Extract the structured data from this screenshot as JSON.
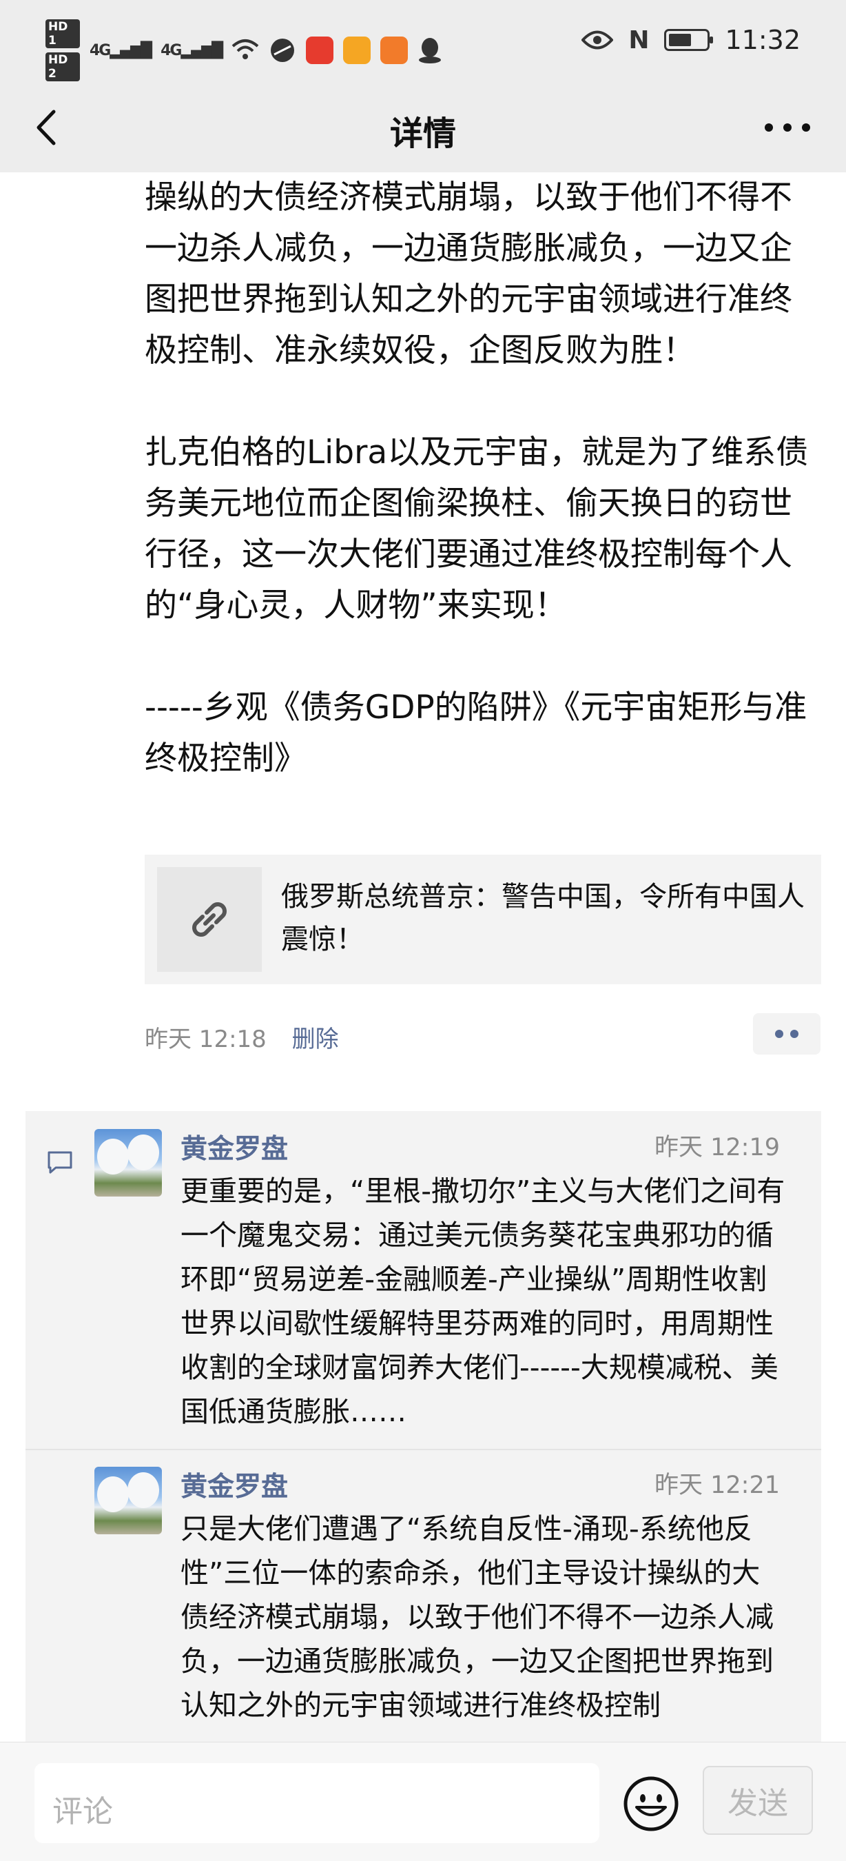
{
  "status_bar": {
    "hd1": "HD 1",
    "hd2": "HD 2",
    "sim1": "4G",
    "sim2": "4G",
    "nfc": "N",
    "time": "11:32"
  },
  "nav": {
    "title": "详情"
  },
  "post": {
    "paragraphs": [
      "操纵的大债经济模式崩塌，以致于他们不得不一边杀人减负，一边通货膨胀减负，一边又企图把世界拖到认知之外的元宇宙领域进行准终极控制、准永续奴役，企图反败为胜！",
      "扎克伯格的Libra以及元宇宙，就是为了维系债务美元地位而企图偷梁换柱、偷天换日的窃世行径，这一次大佬们要通过准终极控制每个人的“身心灵，人财物”来实现！",
      "-----乡观《债务GDP的陷阱》《元宇宙矩形与准终极控制》"
    ],
    "link_title": "俄罗斯总统普京：警告中国，令所有中国人震惊！",
    "time": "昨天 12:18",
    "delete_label": "删除"
  },
  "comments": [
    {
      "name": "黄金罗盘",
      "time": "昨天 12:19",
      "text": "更重要的是，“里根-撒切尔”主义与大佬们之间有一个魔鬼交易：通过美元债务葵花宝典邪功的循环即“贸易逆差-金融顺差-产业操纵”周期性收割世界以间歇性缓解特里芬两难的同时，用周期性收割的全球财富饲养大佬们------大规模减税、美国低通货膨胀……"
    },
    {
      "name": "黄金罗盘",
      "time": "昨天 12:21",
      "text": "只是大佬们遭遇了“系统自反性-涌现-系统他反性”三位一体的索命杀，他们主导设计操纵的大债经济模式崩塌，以致于他们不得不一边杀人减负，一边通货膨胀减负，一边又企图把世界拖到认知之外的元宇宙领域进行准终极控制"
    }
  ],
  "bottom_bar": {
    "placeholder": "评论",
    "send_label": "发送"
  },
  "colors": {
    "link_blue": "#576b95",
    "bar_bg": "#ededed"
  },
  "icons": [
    "back-icon",
    "more-icon",
    "link-icon",
    "comment-icon",
    "emoji-icon",
    "wifi-icon",
    "eye-icon",
    "battery-icon"
  ]
}
